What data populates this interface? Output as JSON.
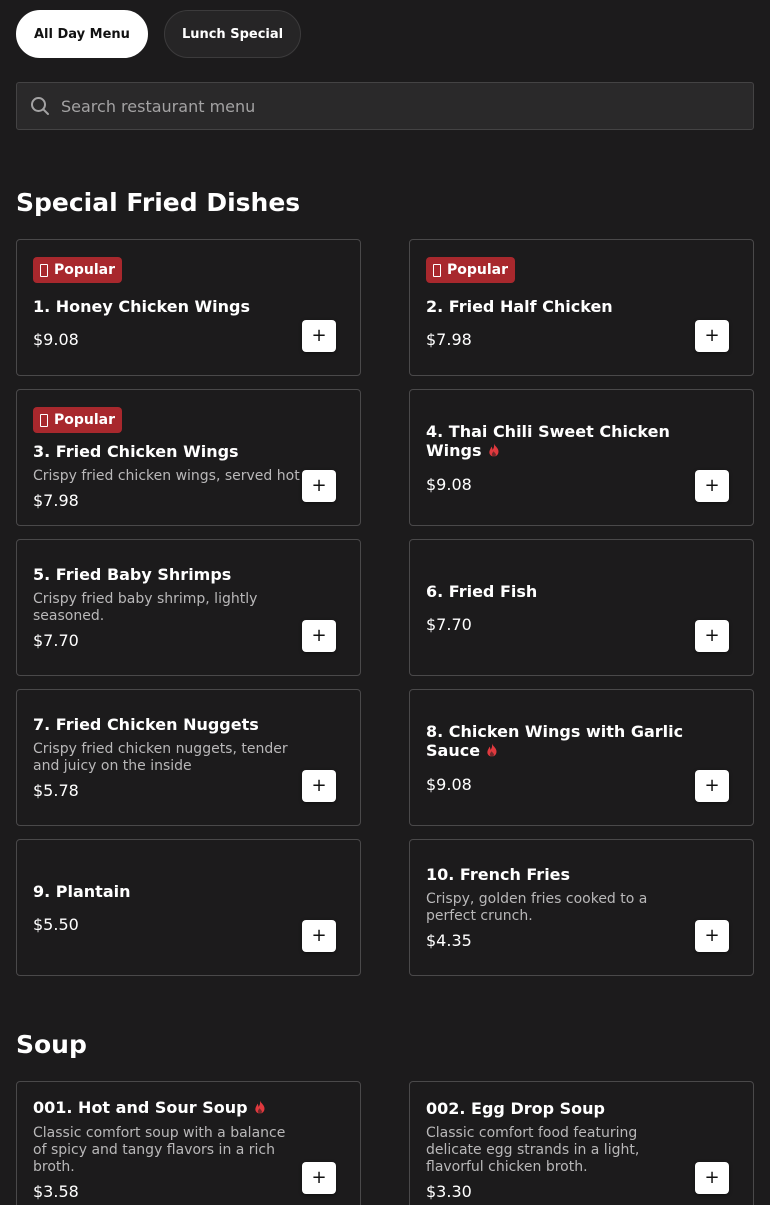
{
  "tabs": [
    {
      "label": "All Day Menu",
      "active": true
    },
    {
      "label": "Lunch Special",
      "active": false
    }
  ],
  "search": {
    "placeholder": "Search restaurant menu",
    "value": "",
    "icon": "search-icon"
  },
  "sections": [
    {
      "title": "Special Fried Dishes",
      "items": [
        {
          "name": "1. Honey Chicken Wings",
          "description": "",
          "price": "$9.08",
          "popular": true,
          "spicy": false
        },
        {
          "name": "2. Fried Half Chicken",
          "description": "",
          "price": "$7.98",
          "popular": true,
          "spicy": false
        },
        {
          "name": "3. Fried Chicken Wings",
          "description": "Crispy fried chicken wings, served hot",
          "price": "$7.98",
          "popular": true,
          "spicy": false
        },
        {
          "name": "4. Thai Chili Sweet Chicken Wings",
          "description": "",
          "price": "$9.08",
          "popular": false,
          "spicy": true
        },
        {
          "name": "5. Fried Baby Shrimps",
          "description": "Crispy fried baby shrimp, lightly seasoned.",
          "price": "$7.70",
          "popular": false,
          "spicy": false
        },
        {
          "name": "6. Fried Fish",
          "description": "",
          "price": "$7.70",
          "popular": false,
          "spicy": false
        },
        {
          "name": "7. Fried Chicken Nuggets",
          "description": "Crispy fried chicken nuggets, tender and juicy on the inside",
          "price": "$5.78",
          "popular": false,
          "spicy": false
        },
        {
          "name": "8. Chicken Wings with Garlic Sauce",
          "description": "",
          "price": "$9.08",
          "popular": false,
          "spicy": true
        },
        {
          "name": "9. Plantain",
          "description": "",
          "price": "$5.50",
          "popular": false,
          "spicy": false
        },
        {
          "name": "10. French Fries",
          "description": "Crispy, golden fries cooked to a perfect crunch.",
          "price": "$4.35",
          "popular": false,
          "spicy": false
        }
      ]
    },
    {
      "title": "Soup",
      "items": [
        {
          "name": "001. Hot and Sour Soup",
          "description": "Classic comfort soup with a balance of spicy and tangy flavors in a rich broth.",
          "price": "$3.58",
          "popular": false,
          "spicy": true
        },
        {
          "name": "002. Egg Drop Soup",
          "description": "Classic comfort food featuring delicate egg strands in a light, flavorful chicken broth.",
          "price": "$3.30",
          "popular": false,
          "spicy": false
        }
      ]
    }
  ],
  "labels": {
    "popular_badge": "Popular",
    "add_button": "+"
  },
  "colors": {
    "background": "#1c1b1c",
    "badge": "#a8282d",
    "spicy": "#e0393e",
    "card_border": "#4a494a"
  }
}
